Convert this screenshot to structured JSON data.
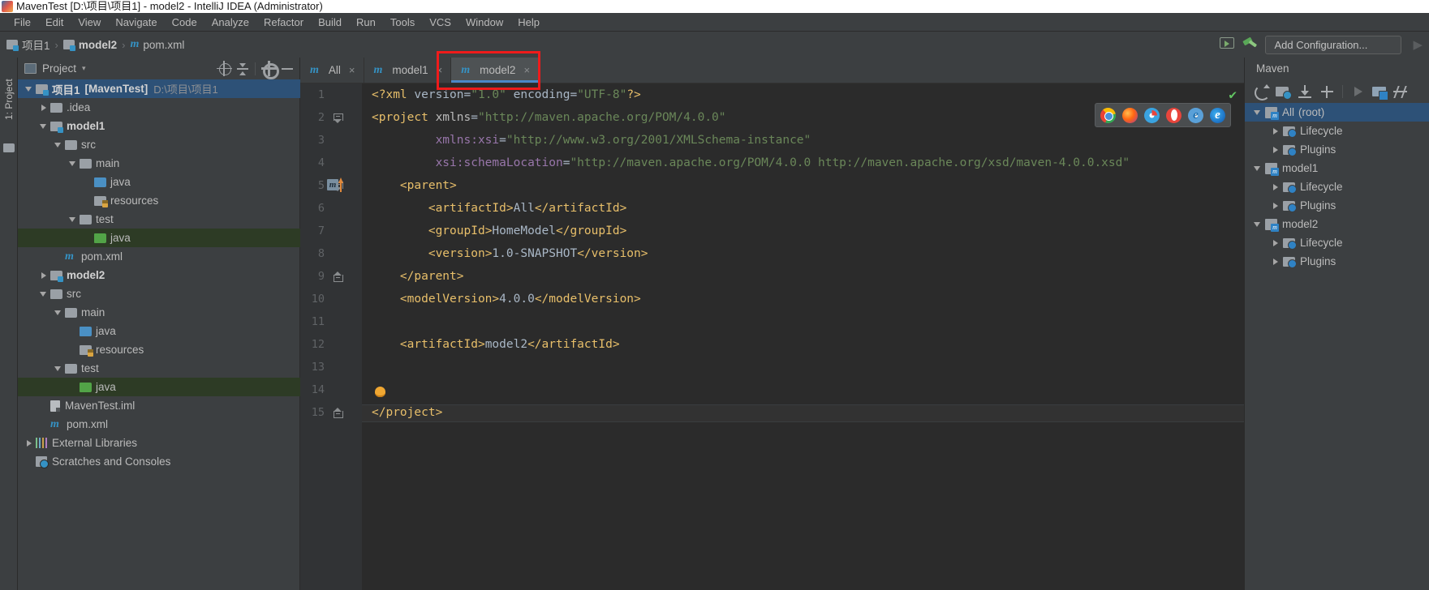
{
  "window": {
    "title": "MavenTest [D:\\项目\\项目1] - model2 - IntelliJ IDEA (Administrator)",
    "icon": "intellij-idea-icon"
  },
  "menubar": {
    "items": [
      {
        "label": "File"
      },
      {
        "label": "Edit"
      },
      {
        "label": "View"
      },
      {
        "label": "Navigate"
      },
      {
        "label": "Code"
      },
      {
        "label": "Analyze"
      },
      {
        "label": "Refactor"
      },
      {
        "label": "Build"
      },
      {
        "label": "Run"
      },
      {
        "label": "Tools"
      },
      {
        "label": "VCS"
      },
      {
        "label": "Window"
      },
      {
        "label": "Help"
      }
    ]
  },
  "navbar": {
    "crumbs": [
      {
        "label": "项目1",
        "icon": "module-icon"
      },
      {
        "label": "model2",
        "icon": "module-icon"
      },
      {
        "label": "pom.xml",
        "icon": "maven-file-icon"
      }
    ],
    "separator": "›",
    "add_configuration": "Add Configuration...",
    "screen_icon": "presentation-icon",
    "build_icon": "hammer-build-icon",
    "run_icon": "run-arrow-icon"
  },
  "left_strip": {
    "project_tab": "1: Project",
    "folder_icon": "folder-icon"
  },
  "project_panel": {
    "title": "Project",
    "caret": "▾",
    "toolbar": [
      {
        "name": "locate-icon"
      },
      {
        "name": "collapse-all-icon"
      },
      {
        "name": "gear-settings-icon"
      },
      {
        "name": "hide-icon"
      }
    ],
    "tree": [
      {
        "indent": 0,
        "arrow": "down",
        "icon": "module-icon",
        "label": "项目1",
        "extra": "[MavenTest]",
        "path": "D:\\项目\\项目1",
        "state": "selected"
      },
      {
        "indent": 1,
        "arrow": "right",
        "icon": "folder-icon",
        "label": ".idea",
        "state": "normal"
      },
      {
        "indent": 1,
        "arrow": "down",
        "icon": "module-icon",
        "label": "model1",
        "bold": true,
        "state": "normal"
      },
      {
        "indent": 2,
        "arrow": "down",
        "icon": "folder-icon",
        "label": "src",
        "state": "normal"
      },
      {
        "indent": 3,
        "arrow": "down",
        "icon": "folder-icon",
        "label": "main",
        "state": "normal"
      },
      {
        "indent": 4,
        "arrow": "none",
        "icon": "folder-blue-icon",
        "label": "java",
        "state": "normal"
      },
      {
        "indent": 4,
        "arrow": "none",
        "icon": "folder-resources-icon",
        "label": "resources",
        "state": "normal"
      },
      {
        "indent": 3,
        "arrow": "down",
        "icon": "folder-icon",
        "label": "test",
        "state": "normal"
      },
      {
        "indent": 4,
        "arrow": "none",
        "icon": "folder-green-icon",
        "label": "java",
        "state": "green"
      },
      {
        "indent": 2,
        "arrow": "none",
        "icon": "maven-file-icon",
        "label": "pom.xml",
        "state": "normal"
      },
      {
        "indent": 1,
        "arrow": "right",
        "icon": "module-icon",
        "label": "model2",
        "bold": true,
        "state": "normal"
      },
      {
        "indent": 1,
        "arrow": "down",
        "icon": "folder-icon",
        "label": "src",
        "state": "normal"
      },
      {
        "indent": 2,
        "arrow": "down",
        "icon": "folder-icon",
        "label": "main",
        "state": "normal"
      },
      {
        "indent": 3,
        "arrow": "none",
        "icon": "folder-blue-icon",
        "label": "java",
        "state": "normal"
      },
      {
        "indent": 3,
        "arrow": "none",
        "icon": "folder-resources-icon",
        "label": "resources",
        "state": "normal"
      },
      {
        "indent": 2,
        "arrow": "down",
        "icon": "folder-icon",
        "label": "test",
        "state": "normal"
      },
      {
        "indent": 3,
        "arrow": "none",
        "icon": "folder-green-icon",
        "label": "java",
        "state": "green"
      },
      {
        "indent": 1,
        "arrow": "none",
        "icon": "iml-file-icon",
        "label": "MavenTest.iml",
        "state": "normal"
      },
      {
        "indent": 1,
        "arrow": "none",
        "icon": "maven-file-icon",
        "label": "pom.xml",
        "state": "normal"
      },
      {
        "indent": 0,
        "arrow": "right",
        "icon": "external-libraries-icon",
        "label": "External Libraries",
        "state": "normal"
      },
      {
        "indent": 0,
        "arrow": "none",
        "icon": "scratches-icon",
        "label": "Scratches and Consoles",
        "state": "normal"
      }
    ]
  },
  "editor": {
    "tabs": [
      {
        "label": "All",
        "icon": "maven-file-icon",
        "close": "×",
        "active": false
      },
      {
        "label": "model1",
        "icon": "maven-file-icon",
        "close": "×",
        "active": false
      },
      {
        "label": "model2",
        "icon": "maven-file-icon",
        "close": "×",
        "active": true
      }
    ],
    "line_numbers": [
      "1",
      "2",
      "3",
      "4",
      "5",
      "6",
      "7",
      "8",
      "9",
      "10",
      "11",
      "12",
      "13",
      "14",
      "15"
    ],
    "inspection_status": "✔",
    "gutter_maven_icon": "maven-reimport-icon",
    "gutter_bulb_icon": "intention-bulb-icon",
    "code_lines": [
      {
        "n": 1,
        "text": "<?xml version=\"1.0\" encoding=\"UTF-8\"?>"
      },
      {
        "n": 2,
        "text": "<project xmlns=\"http://maven.apache.org/POM/4.0.0\""
      },
      {
        "n": 3,
        "text": "         xmlns:xsi=\"http://www.w3.org/2001/XMLSchema-instance\""
      },
      {
        "n": 4,
        "text": "         xsi:schemaLocation=\"http://maven.apache.org/POM/4.0.0 http://maven.apache.org/xsd/maven-4.0.0.xsd\""
      },
      {
        "n": 5,
        "text": "    <parent>"
      },
      {
        "n": 6,
        "text": "        <artifactId>All</artifactId>"
      },
      {
        "n": 7,
        "text": "        <groupId>HomeModel</groupId>"
      },
      {
        "n": 8,
        "text": "        <version>1.0-SNAPSHOT</version>"
      },
      {
        "n": 9,
        "text": "    </parent>"
      },
      {
        "n": 10,
        "text": "    <modelVersion>4.0.0</modelVersion>"
      },
      {
        "n": 11,
        "text": ""
      },
      {
        "n": 12,
        "text": "    <artifactId>model2</artifactId>"
      },
      {
        "n": 13,
        "text": ""
      },
      {
        "n": 14,
        "text": ""
      },
      {
        "n": 15,
        "text": "</project>"
      }
    ],
    "browsers": [
      {
        "name": "chrome-icon"
      },
      {
        "name": "firefox-icon"
      },
      {
        "name": "safari-icon"
      },
      {
        "name": "opera-icon"
      },
      {
        "name": "internet-explorer-icon"
      },
      {
        "name": "edge-icon"
      }
    ]
  },
  "maven_panel": {
    "title": "Maven",
    "toolbar": [
      {
        "name": "reload-icon"
      },
      {
        "name": "add-maven-project-icon"
      },
      {
        "name": "download-sources-icon"
      },
      {
        "name": "add-icon"
      },
      {
        "name": "run-icon"
      },
      {
        "name": "execute-goal-icon"
      },
      {
        "name": "toggle-skip-tests-icon"
      }
    ],
    "tree": [
      {
        "indent": 0,
        "arrow": "down",
        "icon": "maven-project-icon",
        "label": "All",
        "suffix": "(root)",
        "state": "selected"
      },
      {
        "indent": 1,
        "arrow": "right",
        "icon": "maven-folder-icon",
        "label": "Lifecycle",
        "state": "normal"
      },
      {
        "indent": 1,
        "arrow": "right",
        "icon": "maven-folder-icon",
        "label": "Plugins",
        "state": "normal"
      },
      {
        "indent": 0,
        "arrow": "down",
        "icon": "maven-project-icon",
        "label": "model1",
        "state": "normal"
      },
      {
        "indent": 1,
        "arrow": "right",
        "icon": "maven-folder-icon",
        "label": "Lifecycle",
        "state": "normal"
      },
      {
        "indent": 1,
        "arrow": "right",
        "icon": "maven-folder-icon",
        "label": "Plugins",
        "state": "normal"
      },
      {
        "indent": 0,
        "arrow": "down",
        "icon": "maven-project-icon",
        "label": "model2",
        "state": "normal"
      },
      {
        "indent": 1,
        "arrow": "right",
        "icon": "maven-folder-icon",
        "label": "Lifecycle",
        "state": "normal"
      },
      {
        "indent": 1,
        "arrow": "right",
        "icon": "maven-folder-icon",
        "label": "Plugins",
        "state": "normal"
      }
    ]
  },
  "annotations": {
    "highlight_label": "model2-tab-highlight",
    "color": "#ef1b1b"
  }
}
